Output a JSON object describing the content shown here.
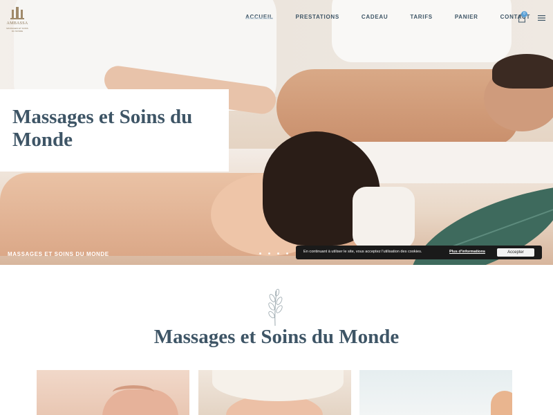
{
  "brand": {
    "name": "AMBASSA",
    "tagline": "MASSAGES ET SOINS DU MONDE",
    "color": "#8f7a5e"
  },
  "nav": {
    "items": [
      {
        "label": "ACCUEIL",
        "active": true
      },
      {
        "label": "PRESTATIONS",
        "active": false
      },
      {
        "label": "CADEAU",
        "active": false
      },
      {
        "label": "TARIFS",
        "active": false
      },
      {
        "label": "PANIER",
        "active": false
      },
      {
        "label": "CONTACT",
        "active": false
      }
    ],
    "cart_count": "0",
    "cart_icon": "shopping-bag-icon",
    "menu_icon": "hamburger-menu-icon"
  },
  "hero": {
    "title": "Massages et Soins du Monde",
    "caption": "MASSAGES ET SOINS DU MONDE",
    "slides": 4
  },
  "cookie": {
    "text": "En continuant à utiliser le site, vous acceptez l'utilisation des cookies.",
    "link": "Plus d'informations",
    "button": "Accepter"
  },
  "section": {
    "icon": "leaf-branch-icon",
    "title": "Massages et Soins du Monde"
  },
  "colors": {
    "heading": "#3e5566",
    "accent": "#5aa0d6",
    "cookie_bg": "#1a1a1a"
  }
}
